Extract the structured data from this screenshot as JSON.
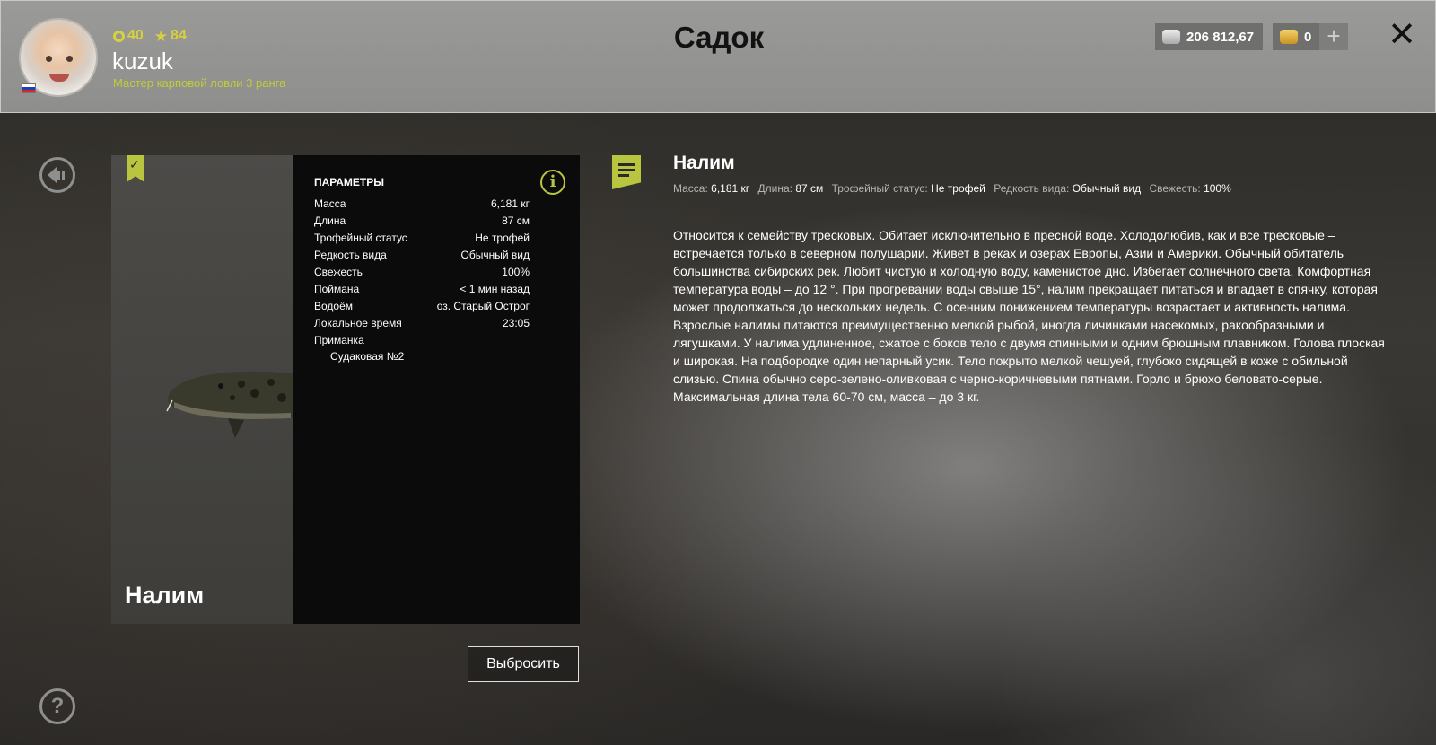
{
  "header": {
    "title": "Садок",
    "level": "40",
    "stars": "84",
    "username": "kuzuk",
    "rank": "Мастер карповой ловли 3 ранга",
    "silver": "206 812,67",
    "gold": "0",
    "plus_label": "+",
    "close_label": "✕"
  },
  "fish": {
    "name": "Налим",
    "params_title": "ПАРАМЕТРЫ",
    "params": [
      {
        "label": "Масса",
        "value": "6,181 кг"
      },
      {
        "label": "Длина",
        "value": "87 см"
      },
      {
        "label": "Трофейный статус",
        "value": "Не трофей"
      },
      {
        "label": "Редкость вида",
        "value": "Обычный вид"
      },
      {
        "label": "Свежесть",
        "value": "100%"
      },
      {
        "label": "Поймана",
        "value": "< 1 мин назад"
      },
      {
        "label": "Водоём",
        "value": "оз. Старый Острог"
      },
      {
        "label": "Локальное время",
        "value": "23:05"
      }
    ],
    "bait_label": "Приманка",
    "bait_value": "Судаковая №2",
    "discard_label": "Выбросить"
  },
  "description": {
    "title": "Налим",
    "meta": [
      {
        "label": "Масса:",
        "value": "6,181 кг"
      },
      {
        "label": "Длина:",
        "value": "87 см"
      },
      {
        "label": "Трофейный статус:",
        "value": "Не трофей"
      },
      {
        "label": "Редкость вида:",
        "value": "Обычный вид"
      },
      {
        "label": "Свежесть:",
        "value": "100%"
      }
    ],
    "text": "Относится к семейству тресковых. Обитает исключительно в пресной воде. Холодолюбив, как и все тресковые – встречается только в северном полушарии. Живет в реках и озерах Европы, Азии и Америки. Обычный обитатель большинства сибирских рек. Любит чистую и холодную воду, каменистое дно. Избегает солнечного света. Комфортная температура воды – до 12 °. При прогревании воды свыше 15°, налим прекращает питаться и впадает в спячку, которая может продолжаться до нескольких недель. С осенним понижением температуры возрастает и активность налима. Взрослые налимы питаются преимущественно мелкой рыбой, иногда личинками насекомых, ракообразными и лягушками. У налима удлиненное, сжатое с боков тело с двумя спинными и одним брюшным плавником. Голова плоская и широкая. На подбородке один непарный усик. Тело покрыто мелкой чешуей, глубоко сидящей в коже с обильной слизью. Спина обычно серо-зелено-оливковая с черно-коричневыми пятнами. Горло и брюхо беловато-серые. Максимальная длина тела 60-70 см, масса – до 3 кг."
  },
  "icons": {
    "level": "level-ring-icon",
    "stars": "star-icon",
    "silver": "silver-coins-icon",
    "gold": "gold-coins-icon",
    "info": "info-icon",
    "bookmark": "bookmark-check-icon",
    "document": "document-icon",
    "back": "back-arrow-icon",
    "help": "help-icon"
  },
  "colors": {
    "accent": "#b9c53e",
    "header_bg": "#9a9a98",
    "stat_yellow": "#d7d23c"
  }
}
